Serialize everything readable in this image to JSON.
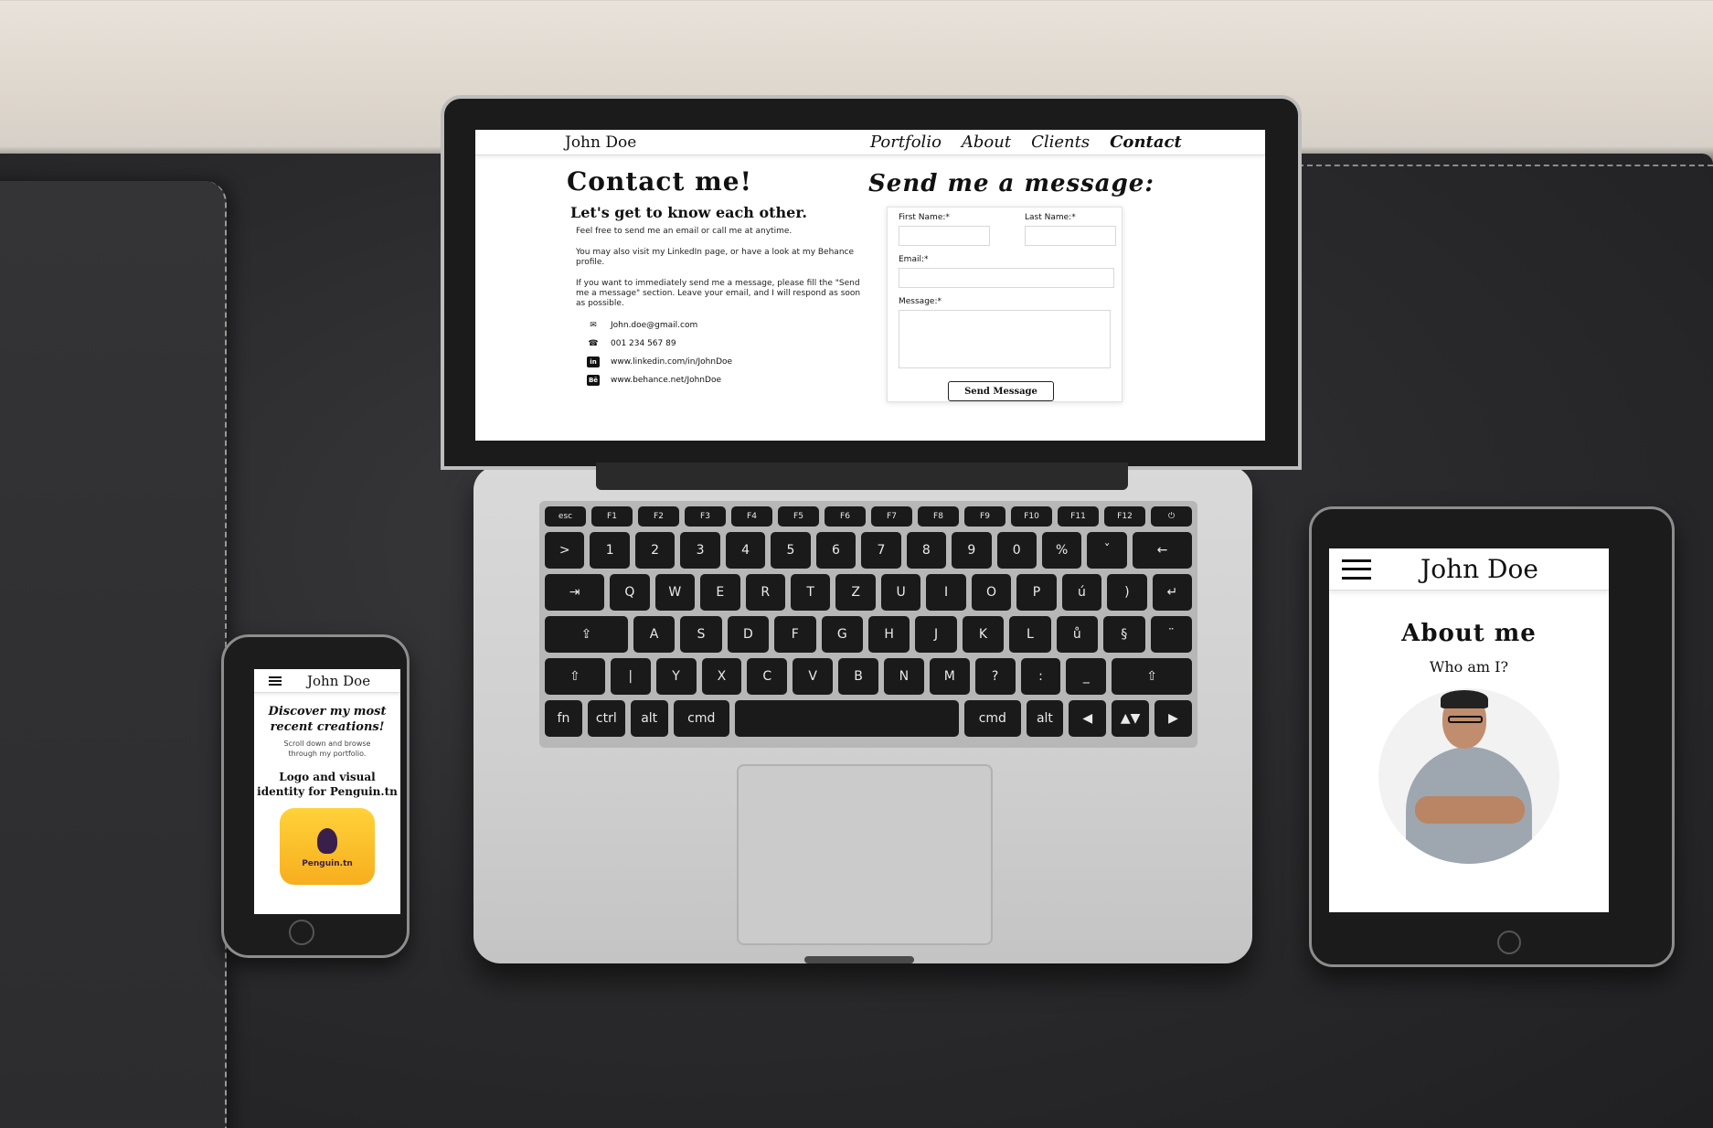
{
  "laptop": {
    "nav": {
      "brand": "John Doe",
      "items": [
        "Portfolio",
        "About",
        "Clients",
        "Contact"
      ],
      "active": "Contact"
    },
    "contact": {
      "title": "Contact me!",
      "subtitle": "Let's get to know each other.",
      "paragraphs": [
        "Feel free to send me an email or call me at anytime.",
        "You may also visit my LinkedIn page, or have a look at my Behance profile.",
        "If you want to immediately send me a message, please fill the \"Send me a message\" section. Leave your email, and I will respond as soon as possible."
      ],
      "email": "John.doe@gmail.com",
      "phone": "001 234 567 89",
      "linkedin": "www.linkedin.com/in/JohnDoe",
      "behance": "www.behance.net/JohnDoe"
    },
    "form": {
      "title": "Send me a message:",
      "first_name_label": "First Name:*",
      "last_name_label": "Last Name:*",
      "email_label": "Email:*",
      "message_label": "Message:*",
      "send_label": "Send Message"
    },
    "keyboard": {
      "fn_row": [
        "esc",
        "F1",
        "F2",
        "F3",
        "F4",
        "F5",
        "F6",
        "F7",
        "F8",
        "F9",
        "F10",
        "F11",
        "F12",
        "⏻"
      ],
      "row1": [
        ">",
        "1",
        "2",
        "3",
        "4",
        "5",
        "6",
        "7",
        "8",
        "9",
        "0",
        "%",
        "ˇ",
        "←"
      ],
      "row2": [
        "⇥",
        "Q",
        "W",
        "E",
        "R",
        "T",
        "Z",
        "U",
        "I",
        "O",
        "P",
        "ú",
        ")",
        "↵"
      ],
      "row3": [
        "⇪",
        "A",
        "S",
        "D",
        "F",
        "G",
        "H",
        "J",
        "K",
        "L",
        "ů",
        "§",
        "¨"
      ],
      "row4": [
        "⇧",
        "|",
        "Y",
        "X",
        "C",
        "V",
        "B",
        "N",
        "M",
        "?",
        ":",
        "_",
        "⇧"
      ],
      "row5": [
        "fn",
        "ctrl",
        "alt",
        "cmd",
        "",
        "cmd",
        "alt",
        "◀",
        "▲▼",
        "▶"
      ]
    }
  },
  "phone": {
    "brand": "John Doe",
    "headline": "Discover my most recent creations!",
    "sub": "Scroll down and browse through my portfolio.",
    "project_title": "Logo and visual identity for Penguin.tn",
    "project_logo_text": "Penguin.tn",
    "tile_color": "#f7ae1e"
  },
  "tablet": {
    "brand": "John Doe",
    "title": "About me",
    "subtitle": "Who am I?"
  }
}
